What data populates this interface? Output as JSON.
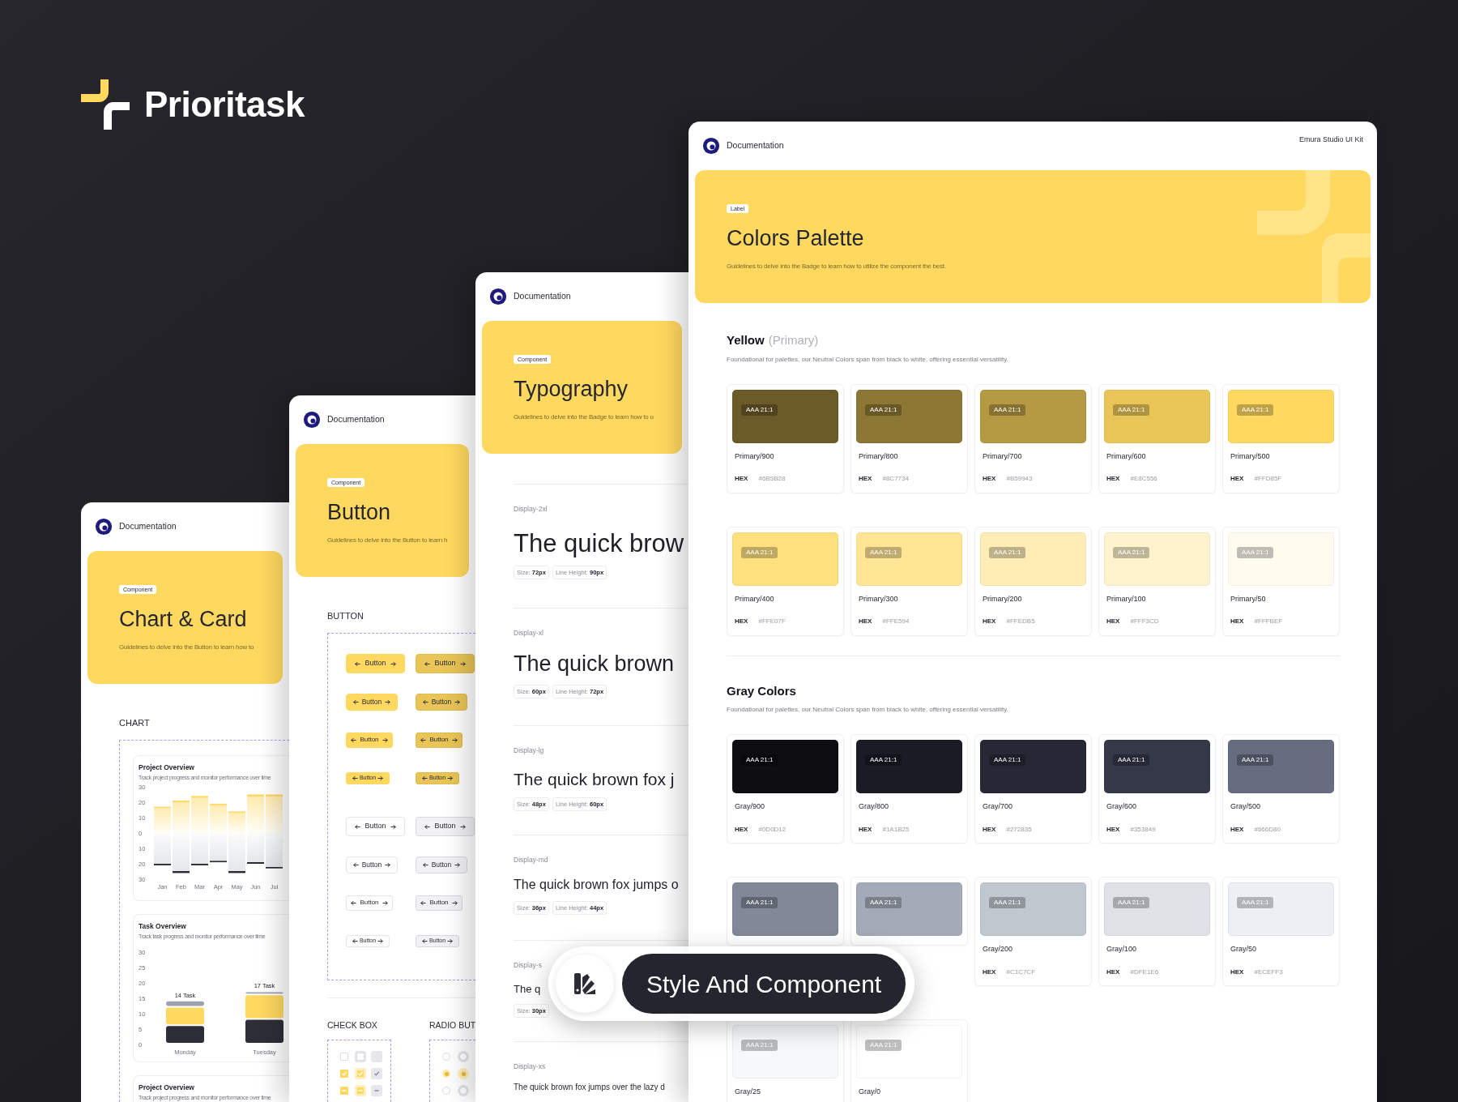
{
  "brand": {
    "name": "Prioritask"
  },
  "chart_page": {
    "header": "Documentation",
    "badge": "Component",
    "title": "Chart & Card",
    "subtitle": "Guidelines to delve into the Button to learn how to",
    "section": "CHART",
    "charts": [
      {
        "title": "Project Overview",
        "subtitle": "Track project progress and monitor performance over time",
        "chart_data": {
          "type": "bar",
          "stacked": true,
          "categories": [
            "Jan",
            "Feb",
            "Mar",
            "Apr",
            "May",
            "Jun",
            "Jul"
          ],
          "series": [
            {
              "color": "#FFD85F",
              "values": [
                17,
                21,
                24,
                19,
                14,
                25,
                25
              ]
            },
            {
              "color": "#2A2A35",
              "values": [
                -21,
                -26,
                -21,
                -19,
                -26,
                -20,
                -23
              ]
            }
          ],
          "ylim": [
            -30,
            30
          ],
          "yticks": [
            {
              "value": 30,
              "label": "30"
            },
            {
              "value": 20,
              "label": "20"
            },
            {
              "value": 10,
              "label": "10"
            },
            {
              "value": 0,
              "label": "0"
            },
            {
              "value": -10,
              "label": "10"
            },
            {
              "value": -20,
              "label": "20"
            },
            {
              "value": -30,
              "label": "30"
            }
          ]
        }
      },
      {
        "title": "Task Overview",
        "subtitle": "Track task progress and monitor performance over time",
        "chart_data": {
          "type": "bar",
          "stacked": true,
          "categories": [
            "Monday",
            "Tuesday"
          ],
          "series": [
            {
              "color": "#2E2E38",
              "values": [
                6,
                8
              ]
            },
            {
              "color": "#FFD85F",
              "values": [
                6,
                8
              ]
            },
            {
              "color": "#9CA3AF",
              "values": [
                2,
                1
              ]
            }
          ],
          "ylim": [
            0,
            30
          ],
          "yticks": [
            30,
            25,
            20,
            15,
            10,
            5,
            0
          ],
          "annotations": [
            "14 Task",
            "17 Task"
          ]
        }
      },
      {
        "title": "Project Overview",
        "subtitle": "Track project progress and monitor performance over time"
      }
    ]
  },
  "button_page": {
    "header": "Documentation",
    "badge": "Component",
    "title": "Button",
    "subtitle": "Guidelines to delve into the Button to learn h",
    "section": "BUTTON",
    "button_rows": [
      {
        "buttons": [
          {
            "label": "Button",
            "kind": "filled"
          },
          {
            "label": "Button",
            "kind": "shaded"
          }
        ]
      },
      {
        "buttons": [
          {
            "label": "Button",
            "kind": "filled"
          },
          {
            "label": "Button",
            "kind": "shaded"
          }
        ]
      },
      {
        "buttons": [
          {
            "label": "Button",
            "kind": "filled"
          },
          {
            "label": "Button",
            "kind": "shaded"
          }
        ]
      },
      {
        "buttons": [
          {
            "label": "Button",
            "kind": "filled"
          },
          {
            "label": "Button",
            "kind": "shaded"
          }
        ]
      },
      {
        "buttons": [
          {
            "label": "Button",
            "kind": "outline"
          },
          {
            "label": "Button",
            "kind": "muted"
          }
        ]
      },
      {
        "buttons": [
          {
            "label": "Button",
            "kind": "outline"
          },
          {
            "label": "Button",
            "kind": "muted"
          }
        ]
      },
      {
        "buttons": [
          {
            "label": "Button",
            "kind": "outline"
          },
          {
            "label": "Button",
            "kind": "muted"
          }
        ]
      },
      {
        "buttons": [
          {
            "label": "Button",
            "kind": "outline"
          },
          {
            "label": "Button",
            "kind": "muted"
          }
        ]
      }
    ],
    "checkbox_section": {
      "title": "CHECK BOX",
      "items": [
        {
          "checked": false,
          "focused": false,
          "disabled": false
        },
        {
          "checked": false,
          "focused": true,
          "disabled": false
        },
        {
          "checked": false,
          "focused": false,
          "disabled": true
        },
        {
          "checked": true,
          "kind": "tick",
          "focused": false,
          "disabled": false
        },
        {
          "checked": true,
          "kind": "tick",
          "focused": true,
          "disabled": false
        },
        {
          "checked": true,
          "kind": "tick",
          "focused": false,
          "disabled": true
        },
        {
          "checked": true,
          "kind": "dash",
          "focused": false,
          "disabled": false
        },
        {
          "checked": true,
          "kind": "dash",
          "focused": true,
          "disabled": false
        },
        {
          "checked": true,
          "kind": "dash",
          "focused": false,
          "disabled": true
        }
      ]
    },
    "radio_section": {
      "title": "RADIO BUT",
      "items": [
        {
          "selected": false,
          "focused": false
        },
        {
          "selected": false,
          "focused": true
        },
        {
          "selected": true,
          "focused": false
        },
        {
          "selected": true,
          "focused": true
        },
        {
          "selected": false,
          "focused": false
        },
        {
          "selected": false,
          "focused": true
        }
      ]
    }
  },
  "typography_page": {
    "header": "Documentation",
    "badge": "Component",
    "title": "Typography",
    "subtitle": "Guidelines to delve into the Badge to learn how to u",
    "styles": [
      {
        "label": "Display-2xl",
        "sample": "The quick brow",
        "chips": [
          "Size: **72px**",
          "Line Height: **90px**"
        ]
      },
      {
        "label": "Display-xl",
        "sample": "The quick brown",
        "chips": [
          "Size: **60px**",
          "Line Height: **72px**"
        ]
      },
      {
        "label": "Display-lg",
        "sample": "The quick brown fox j",
        "chips": [
          "Size: **48px**",
          "Line Height: **60px**"
        ]
      },
      {
        "label": "Display-md",
        "sample": "The quick brown fox jumps o",
        "chips": [
          "Size: **36px**",
          "Line Height: **44px**"
        ]
      },
      {
        "label": "Display-s",
        "sample": "The q",
        "chips": [
          "Size: **30px**"
        ]
      },
      {
        "label": "Display-xs",
        "sample": "The quick brown fox jumps over the lazy d"
      }
    ]
  },
  "colors_page": {
    "header": "Documentation",
    "kit_name": "Emura Studio UI Kit",
    "badge": "Label",
    "title": "Colors Palette",
    "subtitle": "Guidelines to delve into the Badge to learn how to utilize the component the best.",
    "groups": [
      {
        "title": "Yellow",
        "tag": "(Primary)",
        "description": "Foundational for palettes, our Neutral Colors span from black to white, offering essential versatility.",
        "rows": [
          [
            {
              "badge": "AAA 21:1",
              "color": "#6B5B28",
              "name": "Primary/900",
              "hex_label": "HEX",
              "hex": "#6B5B28"
            },
            {
              "badge": "AAA 21:1",
              "color": "#8C7734",
              "name": "Primary/800",
              "hex_label": "HEX",
              "hex": "#8C7734"
            },
            {
              "badge": "AAA 21:1",
              "color": "#B59943",
              "name": "Primary/700",
              "hex_label": "HEX",
              "hex": "#B59943"
            },
            {
              "badge": "AAA 21:1",
              "color": "#E8C556",
              "name": "Primary/600",
              "hex_label": "HEX",
              "hex": "#E8C556"
            },
            {
              "badge": "AAA 21:1",
              "color": "#FFD85F",
              "name": "Primary/500",
              "hex_label": "HEX",
              "hex": "#FFD85F"
            }
          ],
          [
            {
              "badge": "AAA 21:1",
              "color": "#FFE07F",
              "name": "Primary/400",
              "hex_label": "HEX",
              "hex": "#FFE07F"
            },
            {
              "badge": "AAA 21:1",
              "color": "#FFE594",
              "name": "Primary/300",
              "hex_label": "HEX",
              "hex": "#FFE594"
            },
            {
              "badge": "AAA 21:1",
              "color": "#FFEDB5",
              "name": "Primary/200",
              "hex_label": "HEX",
              "hex": "#FFEDB5"
            },
            {
              "badge": "AAA 21:1",
              "color": "#FFF3CD",
              "name": "Primary/100",
              "hex_label": "HEX",
              "hex": "#FFF3CD"
            },
            {
              "badge": "AAA 21:1",
              "color": "#FFFBEF",
              "name": "Primary/50",
              "hex_label": "HEX",
              "hex": "#FFFBEF"
            }
          ]
        ]
      },
      {
        "title": "Gray Colors",
        "description": "Foundational for palettes, our Neutral Colors span from black to white, offering essential versatility.",
        "rows": [
          [
            {
              "badge": "AAA 21:1",
              "color": "#0D0D12",
              "name": "Gray/900",
              "hex_label": "HEX",
              "hex": "#0D0D12"
            },
            {
              "badge": "AAA 21:1",
              "color": "#1A1B25",
              "name": "Gray/800",
              "hex_label": "HEX",
              "hex": "#1A1B25"
            },
            {
              "badge": "AAA 21:1",
              "color": "#272835",
              "name": "Gray/700",
              "hex_label": "HEX",
              "hex": "#272835"
            },
            {
              "badge": "AAA 21:1",
              "color": "#353849",
              "name": "Gray/600",
              "hex_label": "HEX",
              "hex": "#353849"
            },
            {
              "badge": "AAA 21:1",
              "color": "#666D80",
              "name": "Gray/500",
              "hex_label": "HEX",
              "hex": "#666D80"
            }
          ],
          [
            {
              "badge": "AAA 21:1",
              "color": "#818898"
            },
            {
              "badge": "AAA 21:1",
              "color": "#A4ABB8"
            },
            {
              "badge": "AAA 21:1",
              "color": "#C1C7CF",
              "name": "Gray/200",
              "hex_label": "HEX",
              "hex": "#C1C7CF"
            },
            {
              "badge": "AAA 21:1",
              "color": "#DFE1E6",
              "name": "Gray/100",
              "hex_label": "HEX",
              "hex": "#DFE1E6"
            },
            {
              "badge": "AAA 21:1",
              "color": "#ECEFF3",
              "name": "Gray/50",
              "hex_label": "HEX",
              "hex": "#ECEFF3"
            }
          ],
          [
            {
              "badge": "AAA 21:1",
              "color": "#F6F8FA",
              "name": "Gray/25"
            },
            {
              "badge": "AAA 21:1",
              "color": "#FFFFFF",
              "name": "Gray/0"
            }
          ]
        ]
      }
    ]
  },
  "pill": {
    "label": "Style And Component"
  }
}
